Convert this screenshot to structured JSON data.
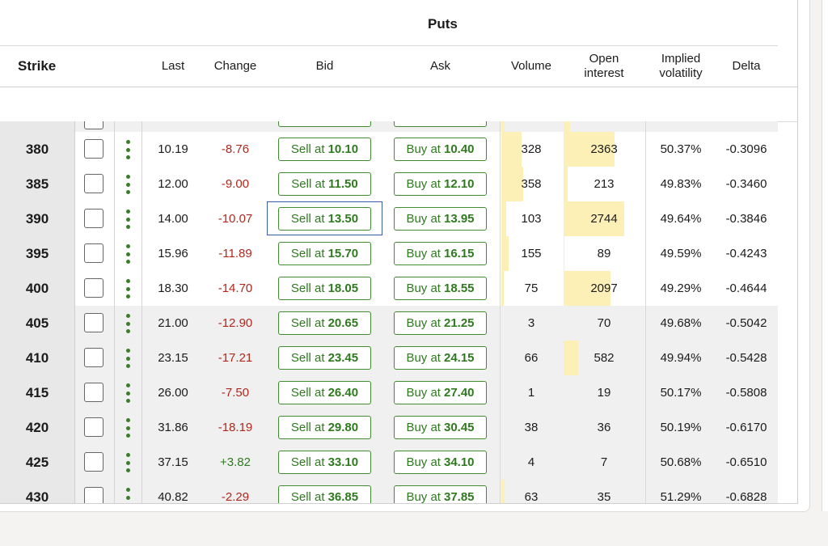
{
  "puts_title": "Puts",
  "headers": {
    "strike": "Strike",
    "last": "Last",
    "change": "Change",
    "bid": "Bid",
    "ask": "Ask",
    "volume": "Volume",
    "open_interest_l1": "Open",
    "open_interest_l2": "interest",
    "iv_l1": "Implied",
    "iv_l2": "volatility",
    "delta": "Delta"
  },
  "sell_prefix": "Sell at",
  "buy_prefix": "Buy at",
  "colors": {
    "accent_green": "#2f7a1f",
    "negative_red": "#b2271c",
    "focus_blue": "#3b5bab",
    "bar_yellow": "#fdf0b6"
  },
  "rows": [
    {
      "strike": "380",
      "last": "10.19",
      "change": "-8.76",
      "bid": "10.10",
      "ask": "10.40",
      "volume": "328",
      "open_interest": "2363",
      "iv": "50.37%",
      "delta": "-0.3096",
      "in_the_money": false,
      "volume_level": 0.33,
      "oi_level": 0.62
    },
    {
      "strike": "385",
      "last": "12.00",
      "change": "-9.00",
      "bid": "11.50",
      "ask": "12.10",
      "volume": "358",
      "open_interest": "213",
      "iv": "49.83%",
      "delta": "-0.3460",
      "in_the_money": false,
      "volume_level": 0.36,
      "oi_level": 0.05
    },
    {
      "strike": "390",
      "last": "14.00",
      "change": "-10.07",
      "bid": "13.50",
      "ask": "13.95",
      "volume": "103",
      "open_interest": "2744",
      "iv": "49.64%",
      "delta": "-0.3846",
      "in_the_money": false,
      "volume_level": 0.08,
      "oi_level": 0.74
    },
    {
      "strike": "395",
      "last": "15.96",
      "change": "-11.89",
      "bid": "15.70",
      "ask": "16.15",
      "volume": "155",
      "open_interest": "89",
      "iv": "49.59%",
      "delta": "-0.4243",
      "in_the_money": false,
      "volume_level": 0.12,
      "oi_level": 0.01
    },
    {
      "strike": "400",
      "last": "18.30",
      "change": "-14.70",
      "bid": "18.05",
      "ask": "18.55",
      "volume": "75",
      "open_interest": "2097",
      "iv": "49.29%",
      "delta": "-0.4644",
      "in_the_money": false,
      "volume_level": 0.04,
      "oi_level": 0.57
    },
    {
      "strike": "405",
      "last": "21.00",
      "change": "-12.90",
      "bid": "20.65",
      "ask": "21.25",
      "volume": "3",
      "open_interest": "70",
      "iv": "49.68%",
      "delta": "-0.5042",
      "in_the_money": true,
      "volume_level": 0,
      "oi_level": 0
    },
    {
      "strike": "410",
      "last": "23.15",
      "change": "-17.21",
      "bid": "23.45",
      "ask": "24.15",
      "volume": "66",
      "open_interest": "582",
      "iv": "49.94%",
      "delta": "-0.5428",
      "in_the_money": true,
      "volume_level": 0,
      "oi_level": 0.18
    },
    {
      "strike": "415",
      "last": "26.00",
      "change": "-7.50",
      "bid": "26.40",
      "ask": "27.40",
      "volume": "1",
      "open_interest": "19",
      "iv": "50.17%",
      "delta": "-0.5808",
      "in_the_money": true,
      "volume_level": 0,
      "oi_level": 0
    },
    {
      "strike": "420",
      "last": "31.86",
      "change": "-18.19",
      "bid": "29.80",
      "ask": "30.45",
      "volume": "38",
      "open_interest": "36",
      "iv": "50.19%",
      "delta": "-0.6170",
      "in_the_money": true,
      "volume_level": 0,
      "oi_level": 0
    },
    {
      "strike": "425",
      "last": "37.15",
      "change": "+3.82",
      "bid": "33.10",
      "ask": "34.10",
      "volume": "4",
      "open_interest": "7",
      "iv": "50.68%",
      "delta": "-0.6510",
      "in_the_money": true,
      "volume_level": 0,
      "oi_level": 0
    },
    {
      "strike": "430",
      "last": "40.82",
      "change": "-2.29",
      "bid": "36.85",
      "ask": "37.85",
      "volume": "63",
      "open_interest": "35",
      "iv": "51.29%",
      "delta": "-0.6828",
      "in_the_money": true,
      "volume_level": 0.05,
      "oi_level": 0
    }
  ],
  "focused_row_index": 2
}
